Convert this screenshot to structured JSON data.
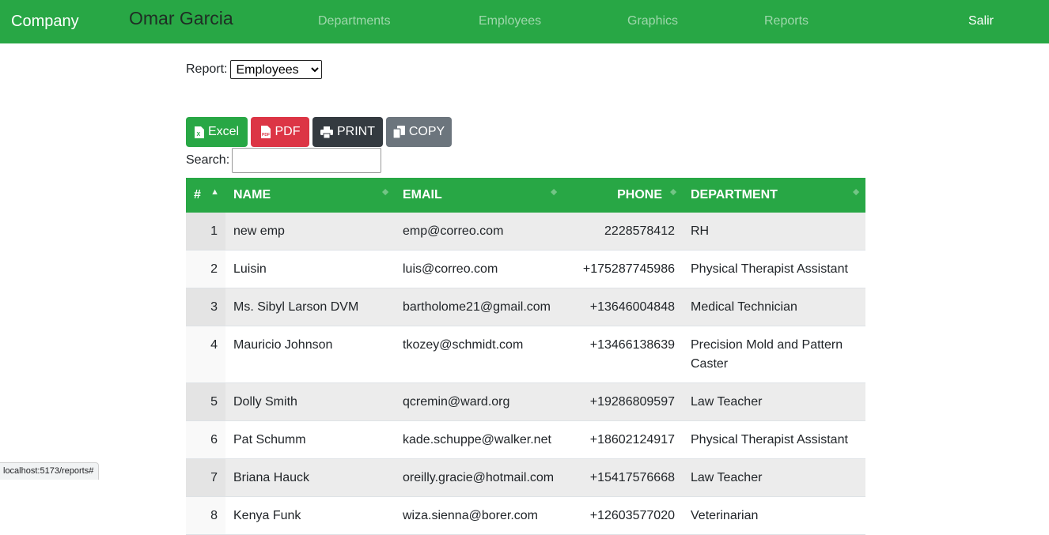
{
  "navbar": {
    "brand": "Company",
    "user_name": "Omar Garcia",
    "links": [
      "Departments",
      "Employees",
      "Graphics",
      "Reports"
    ],
    "logout": "Salir"
  },
  "report": {
    "label": "Report:",
    "selected": "Employees"
  },
  "buttons": {
    "excel": "Excel",
    "pdf": "PDF",
    "print": "PRINT",
    "copy": "COPY"
  },
  "search": {
    "label": "Search:",
    "value": ""
  },
  "table": {
    "headers": [
      "#",
      "NAME",
      "EMAIL",
      "PHONE",
      "DEPARTMENT"
    ],
    "rows": [
      [
        "1",
        "new emp",
        "emp@correo.com",
        "2228578412",
        "RH"
      ],
      [
        "2",
        "Luisin",
        "luis@correo.com",
        "+175287745986",
        "Physical Therapist Assistant"
      ],
      [
        "3",
        "Ms. Sibyl Larson DVM",
        "bartholome21@gmail.com",
        "+13646004848",
        "Medical Technician"
      ],
      [
        "4",
        "Mauricio Johnson",
        "tkozey@schmidt.com",
        "+13466138639",
        "Precision Mold and Pattern Caster"
      ],
      [
        "5",
        "Dolly Smith",
        "qcremin@ward.org",
        "+19286809597",
        "Law Teacher"
      ],
      [
        "6",
        "Pat Schumm",
        "kade.schuppe@walker.net",
        "+18602124917",
        "Physical Therapist Assistant"
      ],
      [
        "7",
        "Briana Hauck",
        "oreilly.gracie@hotmail.com",
        "+15417576668",
        "Law Teacher"
      ],
      [
        "8",
        "Kenya Funk",
        "wiza.sienna@borer.com",
        "+12603577020",
        "Veterinarian"
      ]
    ]
  },
  "status_url": "localhost:5173/reports#",
  "colors": {
    "primary": "#28a745",
    "danger": "#dc3545",
    "dark": "#343a40",
    "secondary": "#6c757d"
  }
}
